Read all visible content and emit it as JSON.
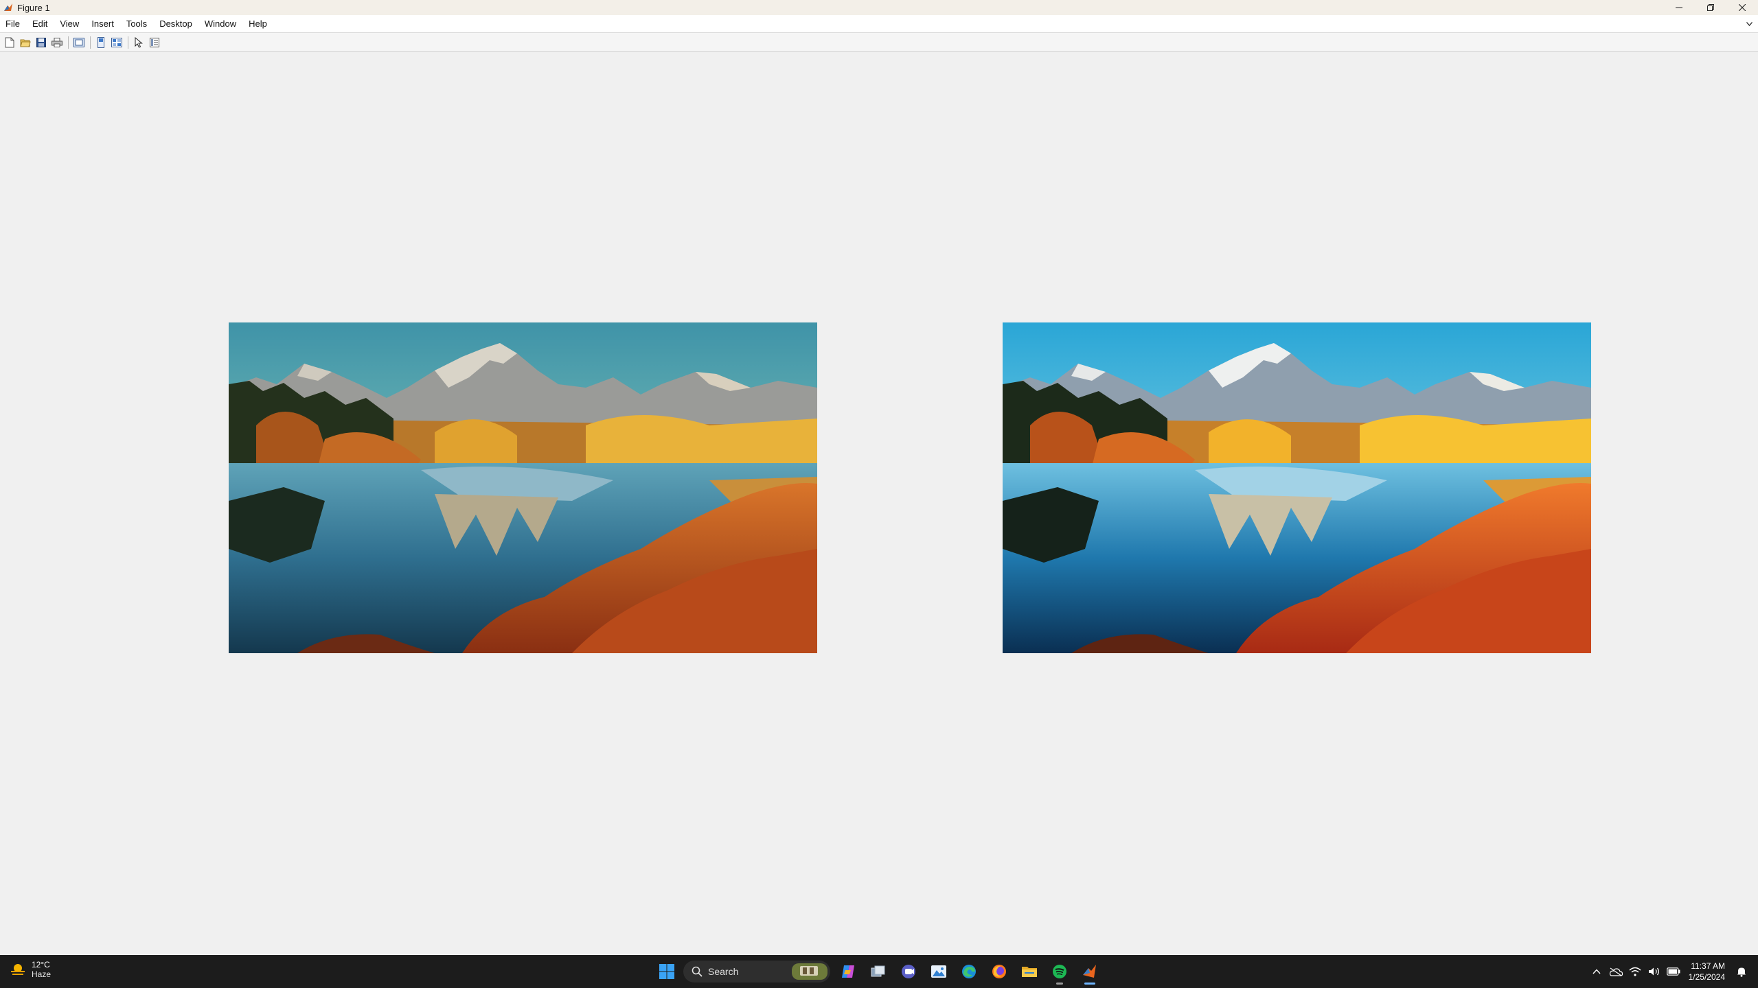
{
  "window": {
    "title": "Figure 1",
    "controls": {
      "minimize": "minimize",
      "restore": "restore",
      "close": "close"
    }
  },
  "menubar": {
    "items": [
      "File",
      "Edit",
      "View",
      "Insert",
      "Tools",
      "Desktop",
      "Window",
      "Help"
    ]
  },
  "toolbar": {
    "buttons": [
      "new-figure-icon",
      "open-file-icon",
      "save-icon",
      "print-icon",
      "link-plot-icon",
      "hide-plot-tools-icon",
      "show-plot-tools-icon",
      "edit-plot-arrow-icon",
      "property-inspector-icon"
    ]
  },
  "figure": {
    "images": [
      {
        "name": "original-landscape-image",
        "subject": "mountain lake autumn scene",
        "filter": "original"
      },
      {
        "name": "processed-landscape-image",
        "subject": "mountain lake autumn scene",
        "filter": "enhanced"
      }
    ]
  },
  "taskbar": {
    "weather": {
      "temp": "12°C",
      "condition": "Haze"
    },
    "search": {
      "label": "Search"
    },
    "apps": [
      "start-icon",
      "copilot-icon",
      "task-view-icon",
      "teams-icon",
      "photos-icon",
      "edge-icon",
      "firefox-icon",
      "file-explorer-icon",
      "spotify-icon",
      "matlab-icon"
    ],
    "tray": [
      "show-hidden-icons-icon",
      "onedrive-icon",
      "wifi-icon",
      "volume-icon",
      "battery-icon",
      "notification-icon"
    ],
    "clock": {
      "time": "11:37 AM",
      "date": "1/25/2024"
    }
  },
  "colors": {
    "accent": "#0078d4",
    "taskbar": "#1c1c1c",
    "canvas": "#f0f0f0",
    "spotify": "#1db954"
  }
}
